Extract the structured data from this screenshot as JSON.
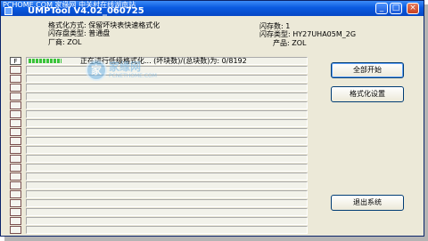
{
  "window": {
    "title": "UMPTool V4.02_060725",
    "watermark_top": "PCHOME.COM 家缘网 中关村在线湖南站",
    "buttons": {
      "minimize": "_",
      "maximize": "□",
      "close": "×"
    }
  },
  "info": {
    "format_mode": "格式化方式: 保留坏块表快速格式化",
    "flash_count": "闪存数: 1",
    "disk_type": "闪存盘类型: 普通盘",
    "flash_type": "闪存类型: HY27UHA05M_2G",
    "vendor": "厂商: ZOL",
    "product": "产品: ZOL"
  },
  "list": {
    "header": "F",
    "first_row_text": "正在进行低级格式化...    (坏块数)/(总块数)为:   0/8192",
    "first_row_progress": 0.12,
    "row_count": 20
  },
  "actions": {
    "start_all": "全部开始",
    "format_settings": "格式化设置",
    "exit": "退出系统"
  },
  "watermark": {
    "logo": "家",
    "text": "家缘网",
    "sub": "PCNETHOME.COM"
  },
  "colors": {
    "titlebar": "#0a5be0",
    "progress": "#3bc43b",
    "window_bg": "#ece9d8"
  }
}
